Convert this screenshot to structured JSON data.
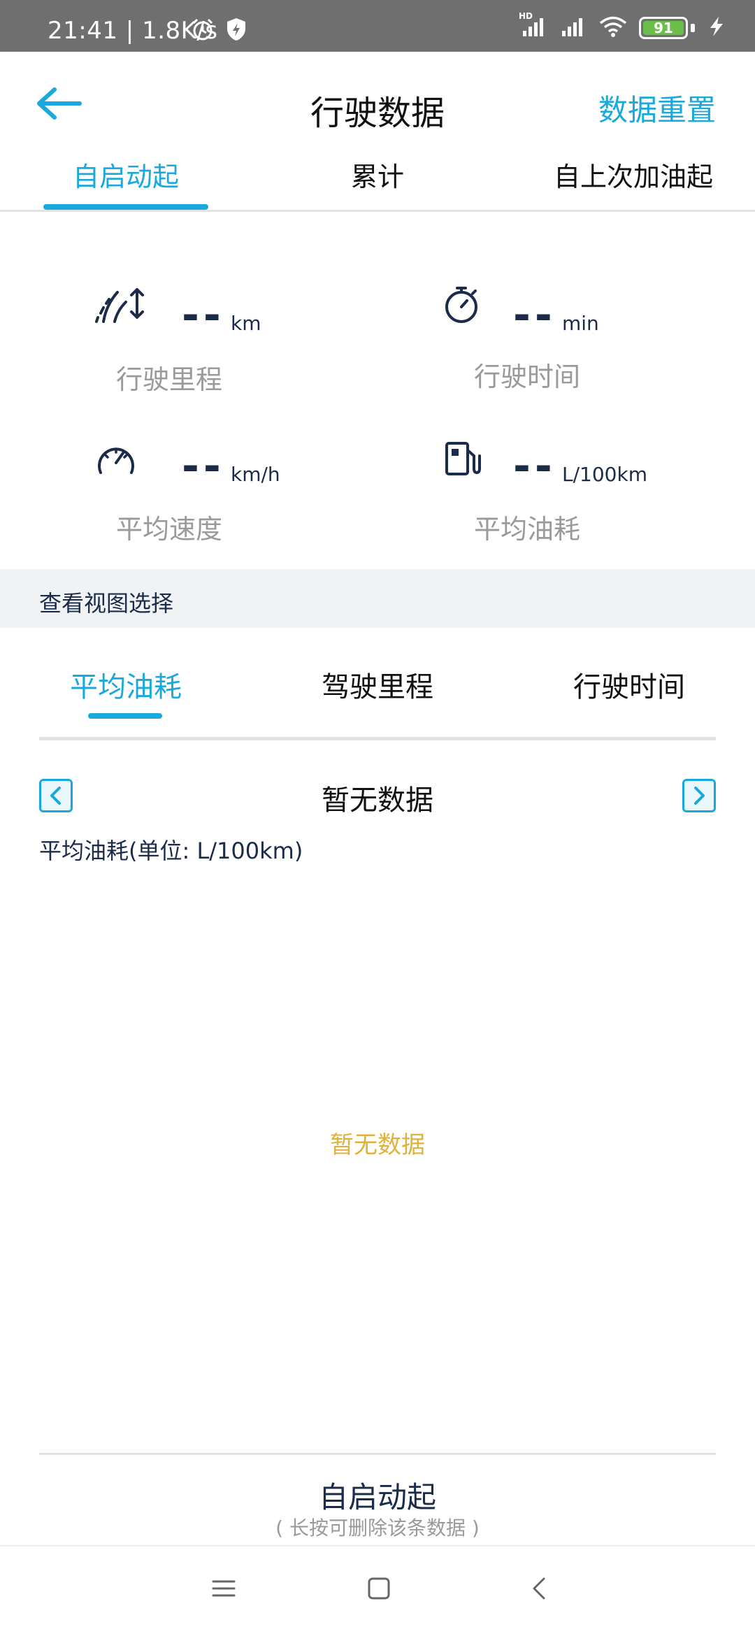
{
  "status_bar": {
    "time": "21:41",
    "network_speed": "1.8K/s",
    "battery": "91",
    "hd_label": "HD"
  },
  "header": {
    "title": "行驶数据",
    "reset_label": "数据重置"
  },
  "top_tabs": [
    {
      "label": "自启动起",
      "active": true
    },
    {
      "label": "累计",
      "active": false
    },
    {
      "label": "自上次加油起",
      "active": false
    }
  ],
  "metrics": [
    {
      "value": "--",
      "unit": "km",
      "label": "行驶里程",
      "icon": "road-icon"
    },
    {
      "value": "--",
      "unit": "min",
      "label": "行驶时间",
      "icon": "stopwatch-icon"
    },
    {
      "value": "--",
      "unit": "km/h",
      "label": "平均速度",
      "icon": "speedometer-icon"
    },
    {
      "value": "--",
      "unit": "L/100km",
      "label": "平均油耗",
      "icon": "fuel-pump-icon"
    }
  ],
  "section": {
    "title": "查看视图选择"
  },
  "view_tabs": [
    {
      "label": "平均油耗",
      "active": true
    },
    {
      "label": "驾驶里程",
      "active": false
    },
    {
      "label": "行驶时间",
      "active": false
    }
  ],
  "chart": {
    "title": "暂无数据",
    "unit_label": "平均油耗(单位: L/100km)",
    "empty_note": "暂无数据"
  },
  "footer": {
    "title": "自启动起",
    "hint": "( 长按可删除该条数据 )"
  },
  "colors": {
    "accent": "#1aa9dc",
    "value_text": "#1b2b4a",
    "label_gray": "#9a9a9a",
    "empty_yellow": "#e0b23c"
  }
}
